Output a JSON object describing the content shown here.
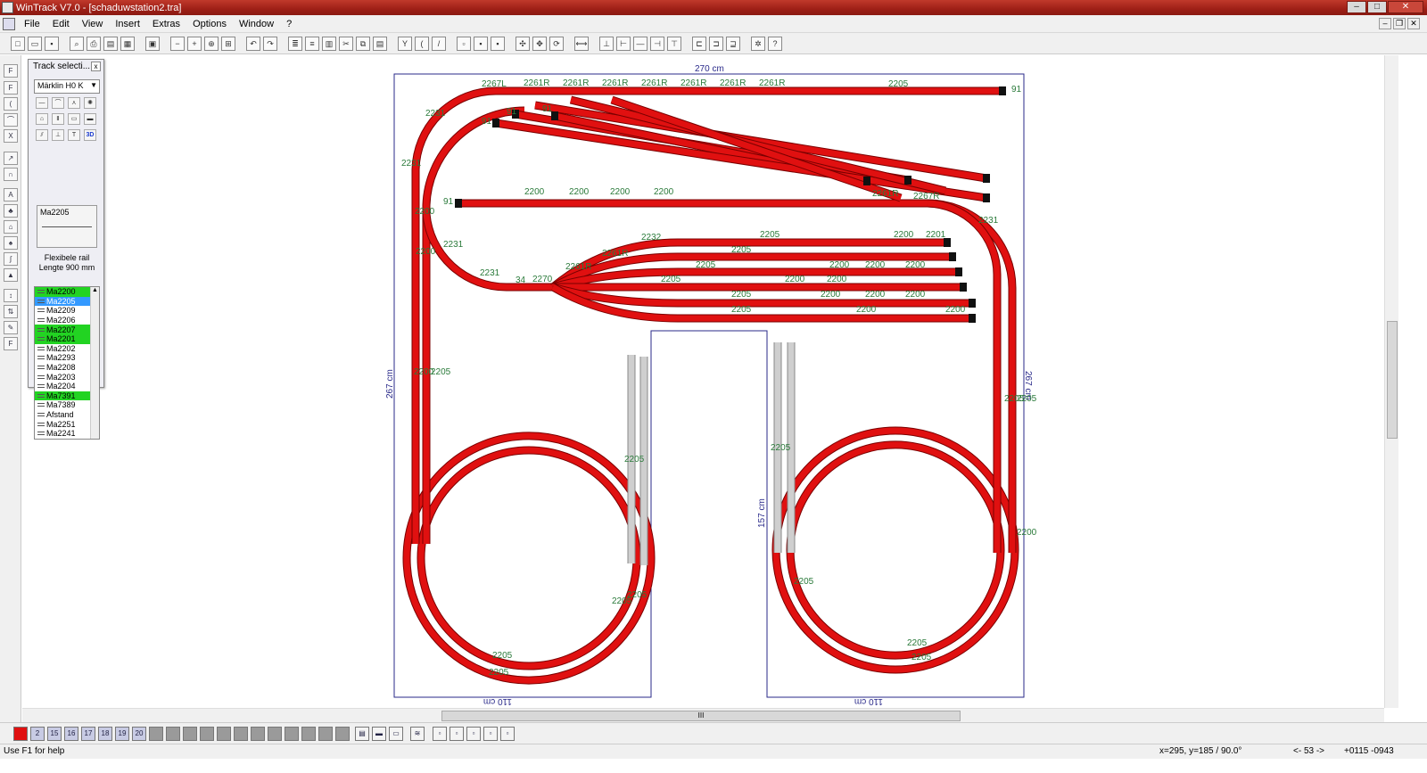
{
  "window": {
    "title": "WinTrack  V7.0 - [schaduwstation2.tra]"
  },
  "menu": [
    "File",
    "Edit",
    "View",
    "Insert",
    "Extras",
    "Options",
    "Window",
    "?"
  ],
  "panel": {
    "title": "Track selecti...",
    "close": "x",
    "manufacturer": "Märklin H0 K",
    "icon_3d": "3D",
    "preview_name": "Ma2205",
    "description_line1": "Flexibele rail",
    "description_line2": "Lengte 900 mm",
    "tracks": [
      {
        "name": "Ma2200",
        "state": "green"
      },
      {
        "name": "Ma2205",
        "state": "selected"
      },
      {
        "name": "Ma2209",
        "state": ""
      },
      {
        "name": "Ma2206",
        "state": ""
      },
      {
        "name": "Ma2207",
        "state": "green"
      },
      {
        "name": "Ma2201",
        "state": "green"
      },
      {
        "name": "Ma2202",
        "state": ""
      },
      {
        "name": "Ma2293",
        "state": ""
      },
      {
        "name": "Ma2208",
        "state": ""
      },
      {
        "name": "Ma2203",
        "state": ""
      },
      {
        "name": "Ma2204",
        "state": ""
      },
      {
        "name": "Ma7391",
        "state": "green"
      },
      {
        "name": "Ma7389",
        "state": ""
      },
      {
        "name": "Afstand",
        "state": ""
      },
      {
        "name": "Ma2251",
        "state": ""
      },
      {
        "name": "Ma2241",
        "state": ""
      }
    ]
  },
  "layout": {
    "dim_top": "270 cm",
    "dim_left": "267 cm",
    "dim_right": "267 cm",
    "dim_bottom_left": "110 cm",
    "dim_bottom_right": "110 cm",
    "dim_inner": "157 cm",
    "track_color": "#e01010",
    "labels": [
      "2267L",
      "2261R",
      "2261R",
      "2261R",
      "2261R",
      "2261R",
      "2261R",
      "2261R",
      "2205",
      "2231",
      "2231",
      "2200",
      "2200",
      "2200",
      "2200",
      "2200",
      "2200",
      "2261R",
      "2267R",
      "2231",
      "2205",
      "2232",
      "2205",
      "2200",
      "2201",
      "2205",
      "2200",
      "2200",
      "2200",
      "2231",
      "2231",
      "34",
      "2270",
      "2261R",
      "2205",
      "2200",
      "2200",
      "2261R",
      "2205",
      "2200",
      "2200",
      "2200",
      "2200",
      "2205",
      "2200",
      "2200",
      "2205",
      "2205",
      "2205",
      "2205",
      "2205",
      "2205",
      "2205",
      "2205",
      "2205",
      "2205",
      "2205",
      "2200",
      "2205",
      "91",
      "91",
      "91",
      "91",
      "91"
    ]
  },
  "layers": [
    "2",
    "15",
    "16",
    "17",
    "18",
    "19",
    "20"
  ],
  "scroll": {
    "bottom_thumb_grip": "III"
  },
  "status": {
    "help": "Use F1 for help",
    "coords": "x=295, y=185 / 90.0°",
    "page": "<- 53 ->",
    "offset": "+0115  -0943"
  }
}
